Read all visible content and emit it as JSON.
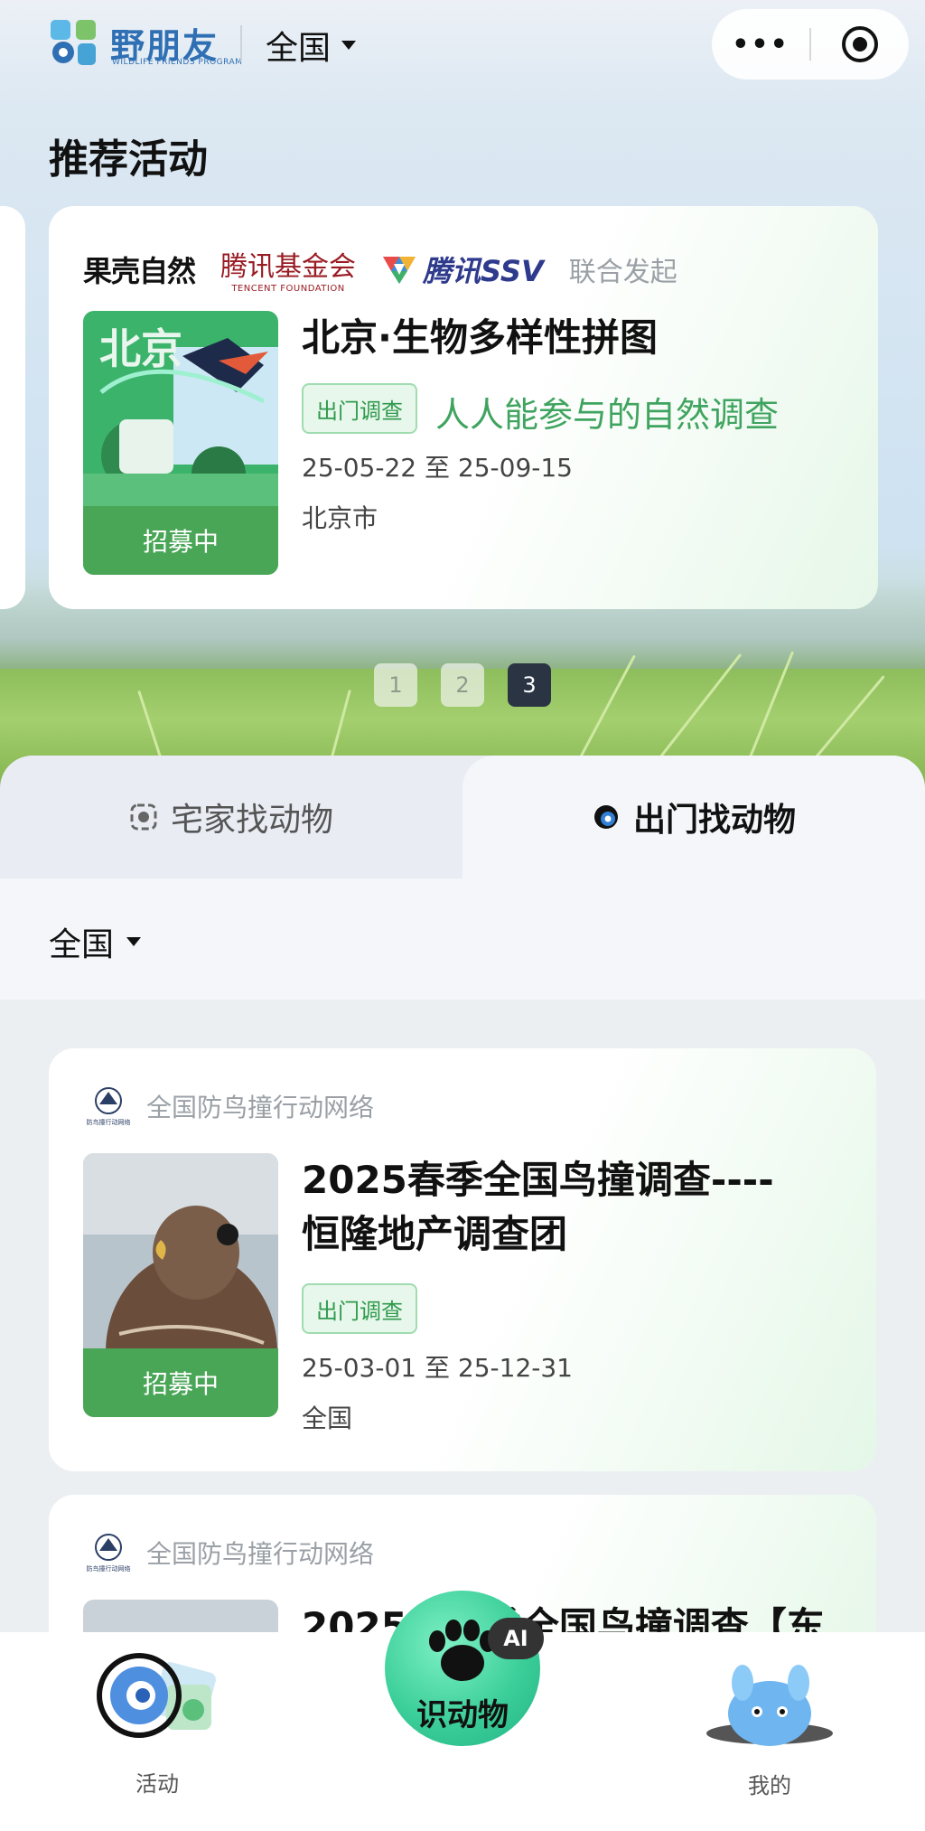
{
  "topbar": {
    "logo_text": "野朋友",
    "logo_sub": "WILDLIFE FRIENDS PROGRAM",
    "region": "全国",
    "more_label": "•••"
  },
  "recommend": {
    "title": "推荐活动",
    "sponsors": {
      "guoke": "果壳自然",
      "tencent_foundation_cn": "腾讯基金会",
      "tencent_foundation_en": "TENCENT FOUNDATION",
      "tencent_ssv": "腾讯SSV",
      "joint": "联合发起"
    },
    "card": {
      "title": "北京·生物多样性拼图",
      "tag": "出门调查",
      "slogan": "人人能参与的自然调查",
      "dates": "25-05-22 至 25-09-15",
      "place": "北京市",
      "status": "招募中",
      "thumb_text": "北京"
    },
    "pages": [
      "1",
      "2",
      "3"
    ],
    "active_page": "3"
  },
  "tabs": {
    "home": "宅家找动物",
    "outdoor": "出门找动物"
  },
  "filter": {
    "region": "全国"
  },
  "list": [
    {
      "org": "全国防鸟撞行动网络",
      "org_logo_text": "防鸟撞行动网络",
      "title_line1": "2025春季全国鸟撞调查----",
      "title_line2": "恒隆地产调查团",
      "tag": "出门调查",
      "dates": "25-03-01 至 25-12-31",
      "place": "全国",
      "status": "招募中"
    },
    {
      "org": "全国防鸟撞行动网络",
      "org_logo_text": "防鸟撞行动网络",
      "title_line1": "2025年春季全国鸟撞调查【东"
    }
  ],
  "bottom_nav": {
    "activity": "活动",
    "identify": "识动物",
    "ai": "AI",
    "mine": "我的"
  },
  "colors": {
    "brand_green": "#4aa657",
    "tag_green": "#2f9a4c",
    "slogan_green": "#3fa45f",
    "logo_blue": "#2f6fb3",
    "active_page": "#2a3442"
  }
}
